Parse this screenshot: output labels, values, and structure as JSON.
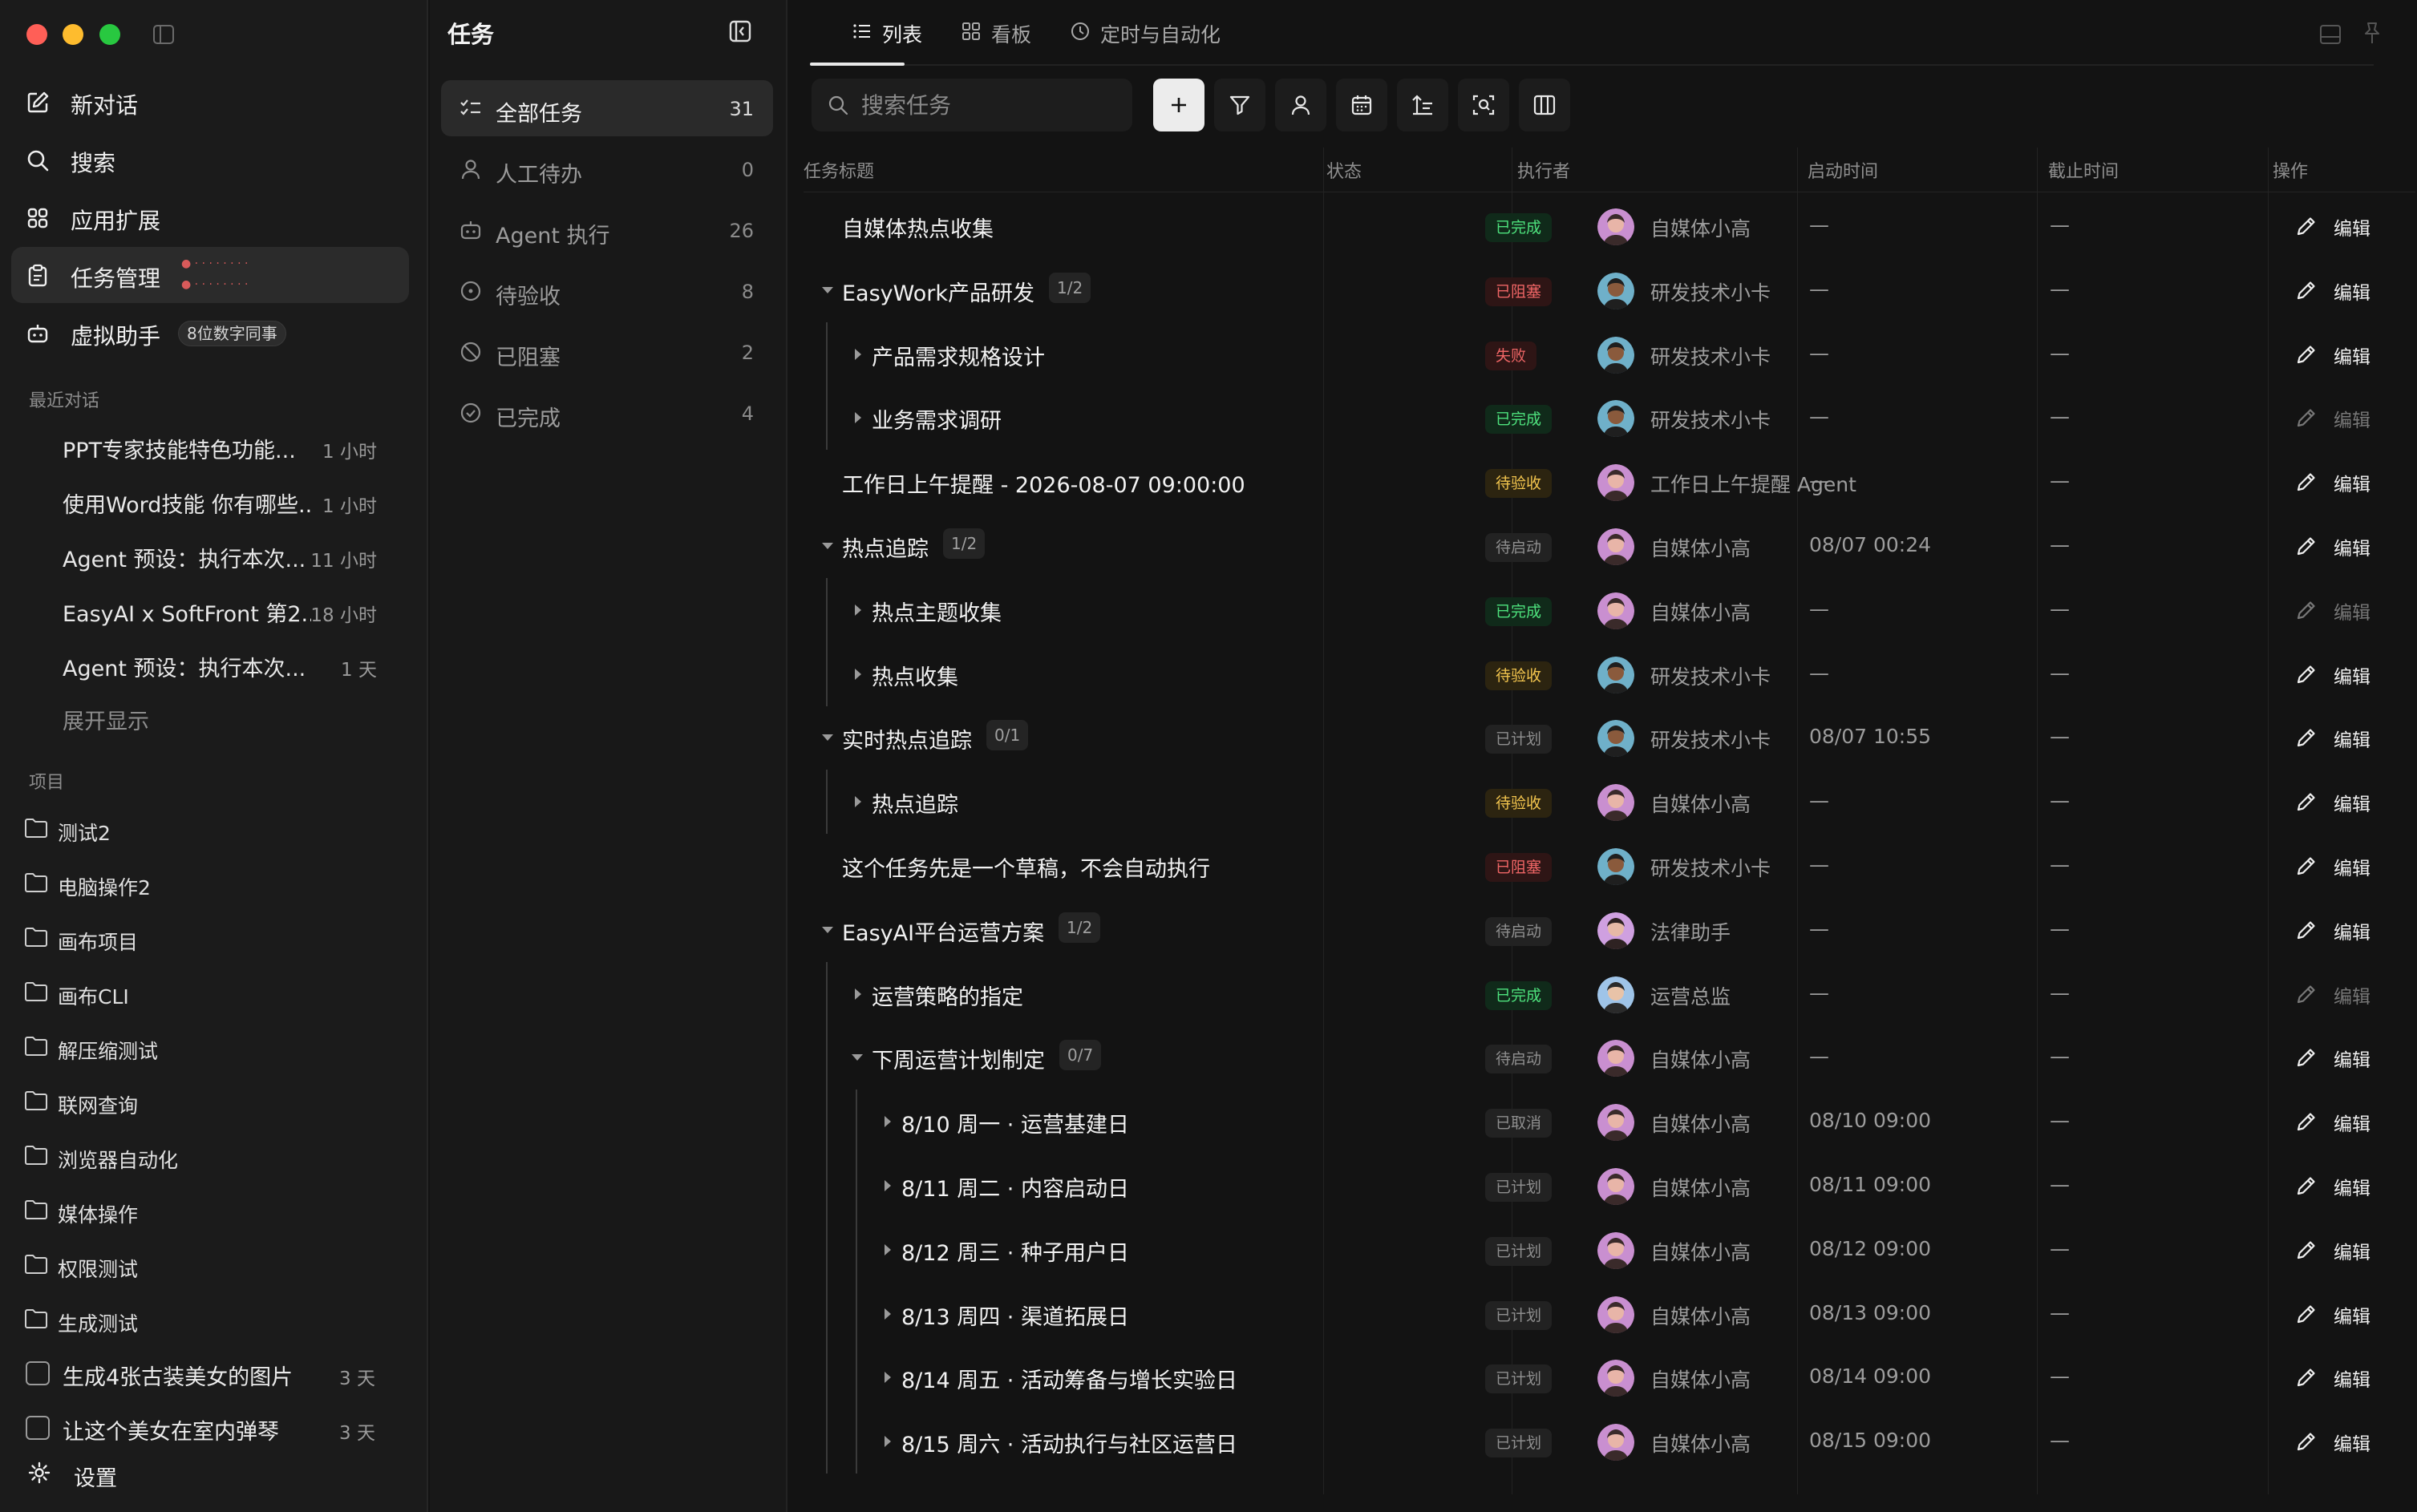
{
  "sidebar": {
    "nav": [
      {
        "label": "新对话",
        "icon": "new-chat-icon"
      },
      {
        "label": "搜索",
        "icon": "search-icon"
      },
      {
        "label": "应用扩展",
        "icon": "apps-icon"
      },
      {
        "label": "任务管理",
        "icon": "clipboard-icon"
      },
      {
        "label": "虚拟助手",
        "icon": "robot-icon"
      }
    ],
    "assistant_badge": "8位数字同事",
    "recent_title": "最近对话",
    "recent": [
      {
        "title": "PPT专家技能特色功能...",
        "time": "1 小时"
      },
      {
        "title": "使用Word技能 你有哪些...",
        "time": "1 小时"
      },
      {
        "title": "Agent 预设：执行本次...",
        "time": "11 小时"
      },
      {
        "title": "EasyAI x SoftFront 第2...",
        "time": "18 小时"
      },
      {
        "title": "Agent 预设：执行本次...",
        "time": "1 天"
      }
    ],
    "expand_label": "展开显示",
    "projects_title": "项目",
    "projects": [
      "测试2",
      "电脑操作2",
      "画布项目",
      "画布CLI",
      "解压缩测试",
      "联网查询",
      "浏览器自动化",
      "媒体操作",
      "权限测试",
      "生成测试"
    ],
    "tasks": [
      {
        "title": "生成4张古装美女的图片",
        "time": "3 天"
      },
      {
        "title": "让这个美女在室内弹琴",
        "time": "3 天"
      }
    ],
    "settings_label": "设置"
  },
  "filter_panel": {
    "title": "任务",
    "items": [
      {
        "label": "全部任务",
        "count": "31",
        "icon": "checklist-icon"
      },
      {
        "label": "人工待办",
        "count": "0",
        "icon": "person-icon"
      },
      {
        "label": "Agent 执行",
        "count": "26",
        "icon": "robot-icon"
      },
      {
        "label": "待验收",
        "count": "8",
        "icon": "pending-circle-icon"
      },
      {
        "label": "已阻塞",
        "count": "2",
        "icon": "blocked-icon"
      },
      {
        "label": "已完成",
        "count": "4",
        "icon": "check-circle-icon"
      }
    ]
  },
  "tabs": [
    {
      "label": "列表",
      "icon": "list-icon"
    },
    {
      "label": "看板",
      "icon": "board-icon"
    },
    {
      "label": "定时与自动化",
      "icon": "clock-icon"
    }
  ],
  "search": {
    "placeholder": "搜索任务"
  },
  "columns": {
    "title": "任务标题",
    "status": "状态",
    "assignee": "执行者",
    "start": "启动时间",
    "due": "截止时间",
    "actions": "操作"
  },
  "edit_label": "编辑",
  "rows": [
    {
      "title": "自媒体热点收集",
      "status": "已完成",
      "assignee": "自媒体小高",
      "start": "—",
      "due": "—"
    },
    {
      "title": "EasyWork产品研发",
      "count": "1/2",
      "status": "已阻塞",
      "assignee": "研发技术小卡",
      "start": "—",
      "due": "—"
    },
    {
      "title": "产品需求规格设计",
      "status": "失败",
      "assignee": "研发技术小卡",
      "start": "—",
      "due": "—"
    },
    {
      "title": "业务需求调研",
      "status": "已完成",
      "assignee": "研发技术小卡",
      "start": "—",
      "due": "—"
    },
    {
      "title": "工作日上午提醒 - 2026-08-07 09:00:00",
      "status": "待验收",
      "assignee": "工作日上午提醒 Agent",
      "start": "—",
      "due": "—"
    },
    {
      "title": "热点追踪",
      "count": "1/2",
      "status": "待启动",
      "assignee": "自媒体小高",
      "start": "08/07 00:24",
      "due": "—"
    },
    {
      "title": "热点主题收集",
      "status": "已完成",
      "assignee": "自媒体小高",
      "start": "—",
      "due": "—"
    },
    {
      "title": "热点收集",
      "status": "待验收",
      "assignee": "研发技术小卡",
      "start": "—",
      "due": "—"
    },
    {
      "title": "实时热点追踪",
      "count": "0/1",
      "status": "已计划",
      "assignee": "研发技术小卡",
      "start": "08/07 10:55",
      "due": "—"
    },
    {
      "title": "热点追踪",
      "status": "待验收",
      "assignee": "自媒体小高",
      "start": "—",
      "due": "—"
    },
    {
      "title": "这个任务先是一个草稿，不会自动执行",
      "status": "已阻塞",
      "assignee": "研发技术小卡",
      "start": "—",
      "due": "—"
    },
    {
      "title": "EasyAI平台运营方案",
      "count": "1/2",
      "status": "待启动",
      "assignee": "法律助手",
      "start": "—",
      "due": "—"
    },
    {
      "title": "运营策略的指定",
      "status": "已完成",
      "assignee": "运营总监",
      "start": "—",
      "due": "—"
    },
    {
      "title": "下周运营计划制定",
      "count": "0/7",
      "status": "待启动",
      "assignee": "自媒体小高",
      "start": "—",
      "due": "—"
    },
    {
      "title": "8/10 周一 · 运营基建日",
      "status": "已取消",
      "assignee": "自媒体小高",
      "start": "08/10 09:00",
      "due": "—"
    },
    {
      "title": "8/11 周二 · 内容启动日",
      "status": "已计划",
      "assignee": "自媒体小高",
      "start": "08/11 09:00",
      "due": "—"
    },
    {
      "title": "8/12 周三 · 种子用户日",
      "status": "已计划",
      "assignee": "自媒体小高",
      "start": "08/12 09:00",
      "due": "—"
    },
    {
      "title": "8/13 周四 · 渠道拓展日",
      "status": "已计划",
      "assignee": "自媒体小高",
      "start": "08/13 09:00",
      "due": "—"
    },
    {
      "title": "8/14 周五 · 活动筹备与增长实验日",
      "status": "已计划",
      "assignee": "自媒体小高",
      "start": "08/14 09:00",
      "due": "—"
    },
    {
      "title": "8/15 周六 · 活动执行与社区运营日",
      "status": "已计划",
      "assignee": "自媒体小高",
      "start": "08/15 09:00",
      "due": "—"
    }
  ],
  "colors": {
    "done": "#4ee27d",
    "blocked": "#ef6565",
    "review": "#f3c54e",
    "idle": "#8f8f8f",
    "traffic_red": "#ff5f57",
    "traffic_yellow": "#febc2e",
    "traffic_green": "#28c840"
  }
}
